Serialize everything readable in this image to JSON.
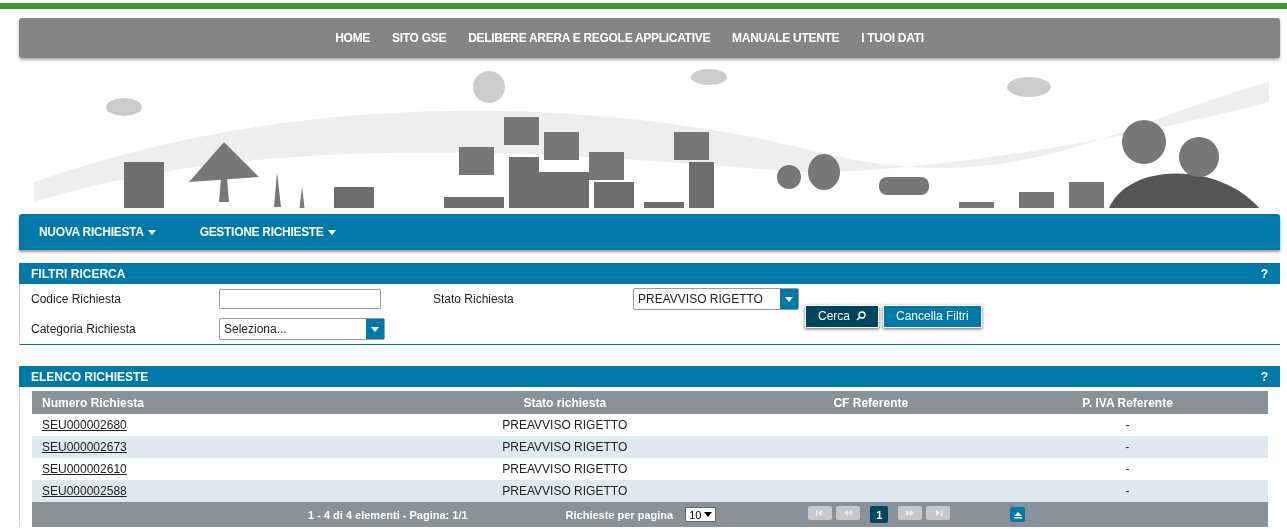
{
  "top_nav": [
    "HOME",
    "SITO GSE",
    "DELIBERE ARERA E REGOLE APPLICATIVE",
    "MANUALE UTENTE",
    "I TUOI DATI"
  ],
  "menu": [
    {
      "label": "NUOVA RICHIESTA"
    },
    {
      "label": "GESTIONE RICHIESTE"
    }
  ],
  "filters": {
    "title": "FILTRI RICERCA",
    "help": "?",
    "fields": [
      {
        "kind": "text",
        "label": "Codice Richiesta"
      },
      {
        "kind": "select",
        "label": "Stato Richiesta",
        "value": "PREAVVISO RIGETTO"
      },
      {
        "kind": "select",
        "label": "Categoria Richiesta",
        "value": "Seleziona..."
      }
    ],
    "buttons": [
      {
        "label": "Cerca",
        "kind": "primary"
      },
      {
        "label": "Cancella Filtri",
        "kind": "secondary"
      }
    ]
  },
  "results": {
    "title": "ELENCO RICHIESTE",
    "help": "?",
    "columns": [
      "Numero Richiesta",
      "Stato richiesta",
      "CF Referente",
      "P. IVA Referente"
    ],
    "rows": [
      {
        "numero": "SEU000002680",
        "stato": "PREAVVISO RIGETTO",
        "piva": "-"
      },
      {
        "numero": "SEU000002673",
        "stato": "PREAVVISO RIGETTO",
        "piva": "-"
      },
      {
        "numero": "SEU000002610",
        "stato": "PREAVVISO RIGETTO",
        "piva": "-"
      },
      {
        "numero": "SEU000002588",
        "stato": "PREAVVISO RIGETTO",
        "piva": "-"
      }
    ],
    "pager": {
      "summary": "1 - 4 di 4 elementi - Pagina: 1/1",
      "per_page_label": "Richieste per pagina",
      "per_page": "10",
      "pages": [
        {
          "label": "1",
          "selected": true
        }
      ],
      "first_disabled": true,
      "prev_disabled": true,
      "next_disabled": true,
      "last_disabled": true
    }
  }
}
